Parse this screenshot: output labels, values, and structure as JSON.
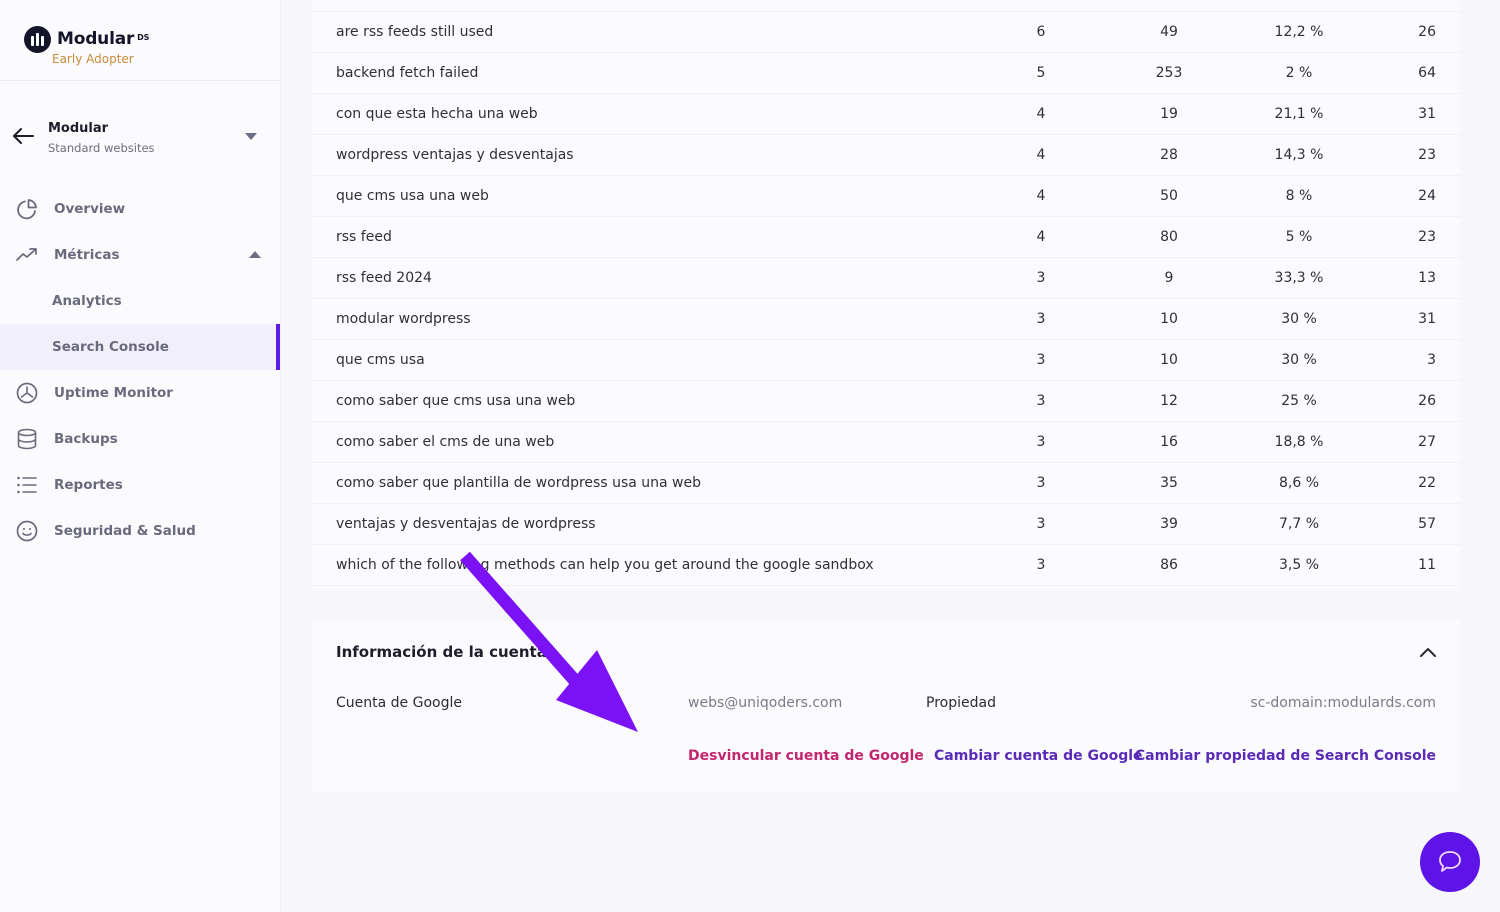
{
  "brand": {
    "name": "Modular",
    "suffix": "DS",
    "tag": "Early Adopter"
  },
  "site": {
    "name": "Modular",
    "type": "Standard websites"
  },
  "nav": {
    "items": [
      {
        "label": "Overview",
        "icon": "pie-chart-icon"
      },
      {
        "label": "Métricas",
        "icon": "trending-up-icon",
        "expanded": true
      },
      {
        "label": "Analytics",
        "sub": true
      },
      {
        "label": "Search Console",
        "sub": true,
        "active": true
      },
      {
        "label": "Uptime Monitor",
        "icon": "gauge-icon"
      },
      {
        "label": "Backups",
        "icon": "database-icon"
      },
      {
        "label": "Reportes",
        "icon": "list-icon"
      },
      {
        "label": "Seguridad & Salud",
        "icon": "smile-icon"
      }
    ]
  },
  "queries": {
    "rows": [
      {
        "query": "are rss feeds still used",
        "clicks": "6",
        "impressions": "49",
        "ctr": "12,2 %",
        "position": "26"
      },
      {
        "query": "backend fetch failed",
        "clicks": "5",
        "impressions": "253",
        "ctr": "2 %",
        "position": "64"
      },
      {
        "query": "con que esta hecha una web",
        "clicks": "4",
        "impressions": "19",
        "ctr": "21,1 %",
        "position": "31"
      },
      {
        "query": "wordpress ventajas y desventajas",
        "clicks": "4",
        "impressions": "28",
        "ctr": "14,3 %",
        "position": "23"
      },
      {
        "query": "que cms usa una web",
        "clicks": "4",
        "impressions": "50",
        "ctr": "8 %",
        "position": "24"
      },
      {
        "query": "rss feed",
        "clicks": "4",
        "impressions": "80",
        "ctr": "5 %",
        "position": "23"
      },
      {
        "query": "rss feed 2024",
        "clicks": "3",
        "impressions": "9",
        "ctr": "33,3 %",
        "position": "13"
      },
      {
        "query": "modular wordpress",
        "clicks": "3",
        "impressions": "10",
        "ctr": "30 %",
        "position": "31"
      },
      {
        "query": "que cms usa",
        "clicks": "3",
        "impressions": "10",
        "ctr": "30 %",
        "position": "3"
      },
      {
        "query": "como saber que cms usa una web",
        "clicks": "3",
        "impressions": "12",
        "ctr": "25 %",
        "position": "26"
      },
      {
        "query": "como saber el cms de una web",
        "clicks": "3",
        "impressions": "16",
        "ctr": "18,8 %",
        "position": "27"
      },
      {
        "query": "como saber que plantilla de wordpress usa una web",
        "clicks": "3",
        "impressions": "35",
        "ctr": "8,6 %",
        "position": "22"
      },
      {
        "query": "ventajas y desventajas de wordpress",
        "clicks": "3",
        "impressions": "39",
        "ctr": "7,7 %",
        "position": "57"
      },
      {
        "query": "which of the following methods can help you get around the google sandbox",
        "clicks": "3",
        "impressions": "86",
        "ctr": "3,5 %",
        "position": "11"
      }
    ]
  },
  "account": {
    "title": "Información de la cuenta",
    "google_label": "Cuenta de Google",
    "google_value": "webs@uniqoders.com",
    "property_label": "Propiedad",
    "property_value": "sc-domain:modulards.com",
    "unlink_label": "Desvincular cuenta de Google",
    "change_account_label": "Cambiar cuenta de Google",
    "change_property_label": "Cambiar propiedad de Search Console"
  },
  "colors": {
    "accent": "#5b1ee0",
    "danger_link": "#c2266f",
    "primary_link": "#5a2bb8",
    "brand_tag": "#c98a3c",
    "annotation_arrow": "#7a12f5"
  }
}
